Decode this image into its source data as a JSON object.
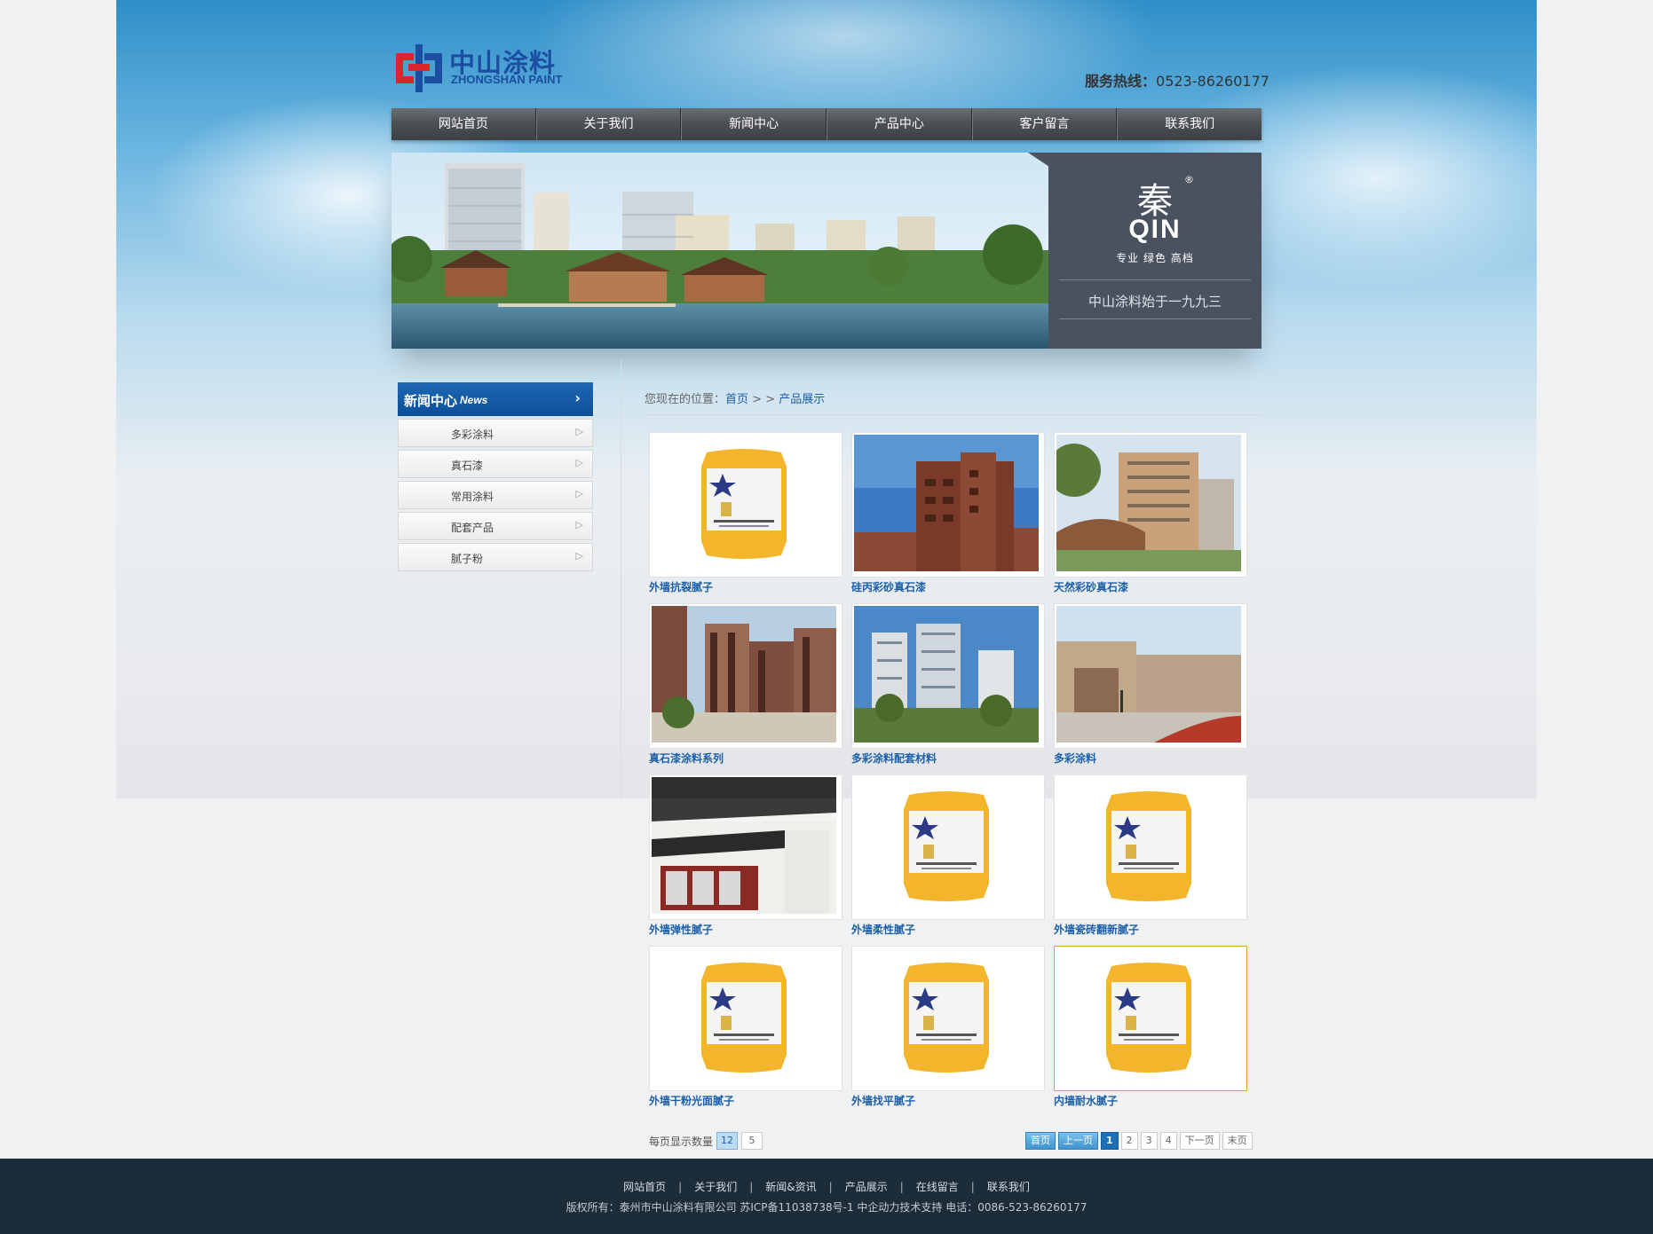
{
  "header": {
    "logo_cn": "中山涂料",
    "logo_en": "ZHONGSHAN PAINT",
    "hotline_label": "服务热线：",
    "hotline_number": "0523-86260177"
  },
  "nav": [
    "网站首页",
    "关于我们",
    "新闻中心",
    "产品中心",
    "客户留言",
    "联系我们"
  ],
  "banner": {
    "brand_cn": "秦",
    "brand_en": "QIN",
    "slogan": "专业  绿色  高档",
    "tagline": "中山涂料始于一九九三"
  },
  "sidebar": {
    "title_cn": "新闻中心",
    "title_en": "News",
    "arrow": "›",
    "items": [
      "多彩涂料",
      "真石漆",
      "常用涂料",
      "配套产品",
      "腻子粉"
    ]
  },
  "breadcrumb": {
    "prefix": "您现在的位置：",
    "home": "首页",
    "separator": " > > ",
    "current": "产品展示"
  },
  "products": [
    {
      "name": "外墙抗裂腻子",
      "image": "putty-bag"
    },
    {
      "name": "硅丙彩砂真石漆",
      "image": "brick-building"
    },
    {
      "name": "天然彩砂真石漆",
      "image": "apartment-gate"
    },
    {
      "name": "真石漆涂料系列",
      "image": "tall-towers"
    },
    {
      "name": "多彩涂料配套材料",
      "image": "blue-towers"
    },
    {
      "name": "多彩涂料",
      "image": "gatehouse"
    },
    {
      "name": "外墙弹性腻子",
      "image": "chinese-house"
    },
    {
      "name": "外墙柔性腻子",
      "image": "putty-bag"
    },
    {
      "name": "外墙瓷砖翻新腻子",
      "image": "putty-bag"
    },
    {
      "name": "外墙干粉光面腻子",
      "image": "putty-bag"
    },
    {
      "name": "外墙找平腻子",
      "image": "putty-bag"
    },
    {
      "name": "内墙耐水腻子",
      "image": "putty-bag"
    }
  ],
  "pagination": {
    "perpage_label": "每页显示数量",
    "perpage_options": [
      "12",
      "5"
    ],
    "perpage_selected": "12",
    "first": "首页",
    "prev": "上一页",
    "pages": [
      "1",
      "2",
      "3",
      "4"
    ],
    "current_page": "1",
    "next": "下一页",
    "last": "末页"
  },
  "footer": {
    "links": [
      "网站首页",
      "关于我们",
      "新闻&资讯",
      "产品展示",
      "在线留言",
      "联系我们"
    ],
    "separator": "|",
    "copyright": "版权所有：泰州市中山涂料有限公司 苏ICP备11038738号-1 中企动力技术支持 电话：0086-523-86260177"
  },
  "colors": {
    "accent_blue": "#1d5fa8",
    "nav_dark": "#4d5055",
    "footer_bg": "#1d2c39",
    "active_border": "#e0a12a"
  }
}
